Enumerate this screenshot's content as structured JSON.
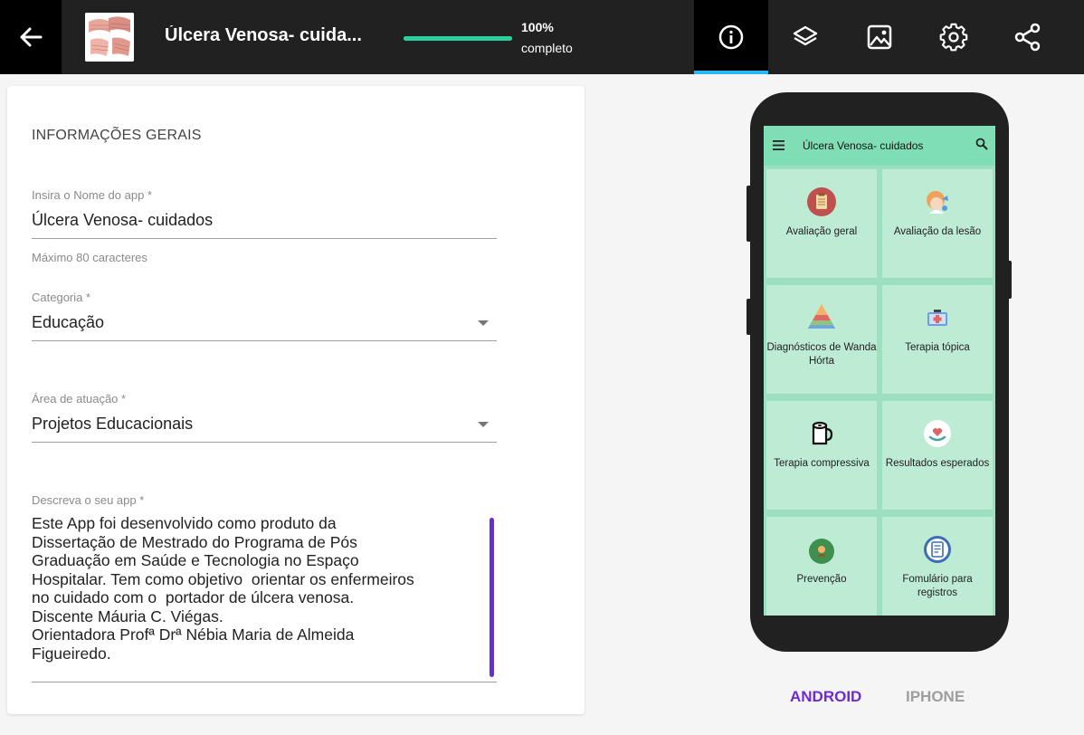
{
  "header": {
    "app_title": "Úlcera Venosa- cuida...",
    "progress_percent": "100%",
    "progress_value": 1.0,
    "progress_label": "completo",
    "accent": "#29b6f6",
    "progress_color": "#2bd09b"
  },
  "toolbar": {
    "icons": [
      "info-icon",
      "layers-icon",
      "image-icon",
      "settings-icon",
      "share-icon"
    ]
  },
  "form": {
    "section_title": "INFORMAÇÕES GERAIS",
    "name_label": "Insira o Nome do app *",
    "name_value": "Úlcera Venosa- cuidados",
    "name_helper": "Máximo 80 caracteres",
    "category_label": "Categoria *",
    "category_value": "Educação",
    "area_label": "Área de atuação *",
    "area_value": "Projetos Educacionais",
    "description_label": "Descreva o seu app *",
    "description_value": "Este App foi desenvolvido como produto da\nDissertação de Mestrado do Programa de Pós\nGraduação em Saúde e Tecnologia no Espaço\nHospitalar. Tem como objetivo  orientar os enfermeiros\nno cuidado com o  portador de úlcera venosa.\nDiscente Máuria C. Viégas.\nOrientadora Profª Drª Nébia Maria de Almeida\nFigueiredo.",
    "scrollbar_color": "#6f2bd3"
  },
  "preview": {
    "app_title": "Úlcera Venosa- cuidados",
    "tiles": [
      {
        "label": "Avaliação geral"
      },
      {
        "label": "Avaliação da lesão"
      },
      {
        "label": "Diagnósticos de Wanda Hórta"
      },
      {
        "label": "Terapia tópica"
      },
      {
        "label": "Terapia compressiva"
      },
      {
        "label": "Resultados esperados"
      },
      {
        "label": "Prevenção"
      },
      {
        "label": "Fomulário para registros"
      }
    ],
    "screen_color": "#9de0c0",
    "tile_color": "#bdebd4"
  },
  "platform": {
    "android_label": "ANDROID",
    "iphone_label": "IPHONE",
    "selected": "ANDROID",
    "selected_color": "#6f2bd3"
  }
}
